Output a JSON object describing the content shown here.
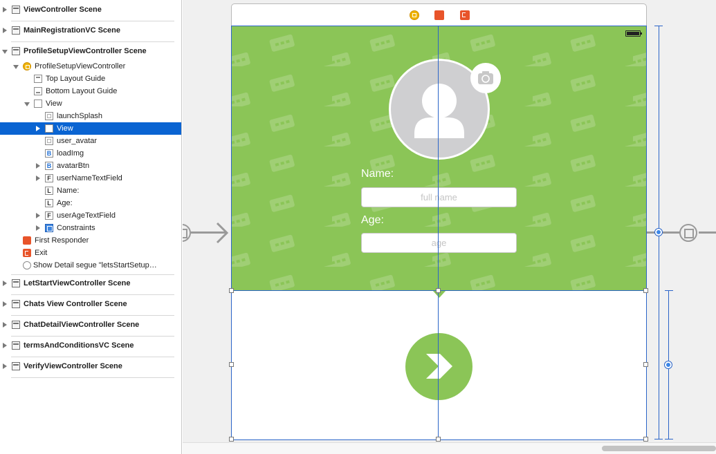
{
  "outline": {
    "rows": [
      {
        "label": "ViewController Scene"
      },
      {
        "label": "MainRegistrationVC Scene"
      },
      {
        "label": "ProfileSetupViewController Scene"
      },
      {
        "label": "ProfileSetupViewController"
      },
      {
        "label": "Top Layout Guide"
      },
      {
        "label": "Bottom Layout Guide"
      },
      {
        "label": "View"
      },
      {
        "label": "launchSplash"
      },
      {
        "label": "View"
      },
      {
        "label": "user_avatar"
      },
      {
        "label": "loadImg"
      },
      {
        "label": "avatarBtn"
      },
      {
        "label": "userNameTextField"
      },
      {
        "label": "Name:"
      },
      {
        "label": "Age:"
      },
      {
        "label": "userAgeTextField"
      },
      {
        "label": "Constraints"
      },
      {
        "label": "First Responder"
      },
      {
        "label": "Exit"
      },
      {
        "label": "Show Detail segue \"letsStartSetup…"
      },
      {
        "label": "LetStartViewController Scene"
      },
      {
        "label": "Chats View Controller Scene"
      },
      {
        "label": "ChatDetailViewController Scene"
      },
      {
        "label": "termsAndConditionsVC Scene"
      },
      {
        "label": "VerifyViewController Scene"
      }
    ],
    "icon_letters": {
      "button": "B",
      "textfield": "F",
      "label": "L"
    }
  },
  "canvas": {
    "name_label": "Name:",
    "name_placeholder": "full name",
    "age_label": "Age:",
    "age_placeholder": "age"
  },
  "colors": {
    "accent_green": "#8bc557",
    "selection_blue": "#0a64d2",
    "constraint_blue": "#2a64c8",
    "object_orange": "#e8542a",
    "vc_yellow": "#f0b400"
  }
}
